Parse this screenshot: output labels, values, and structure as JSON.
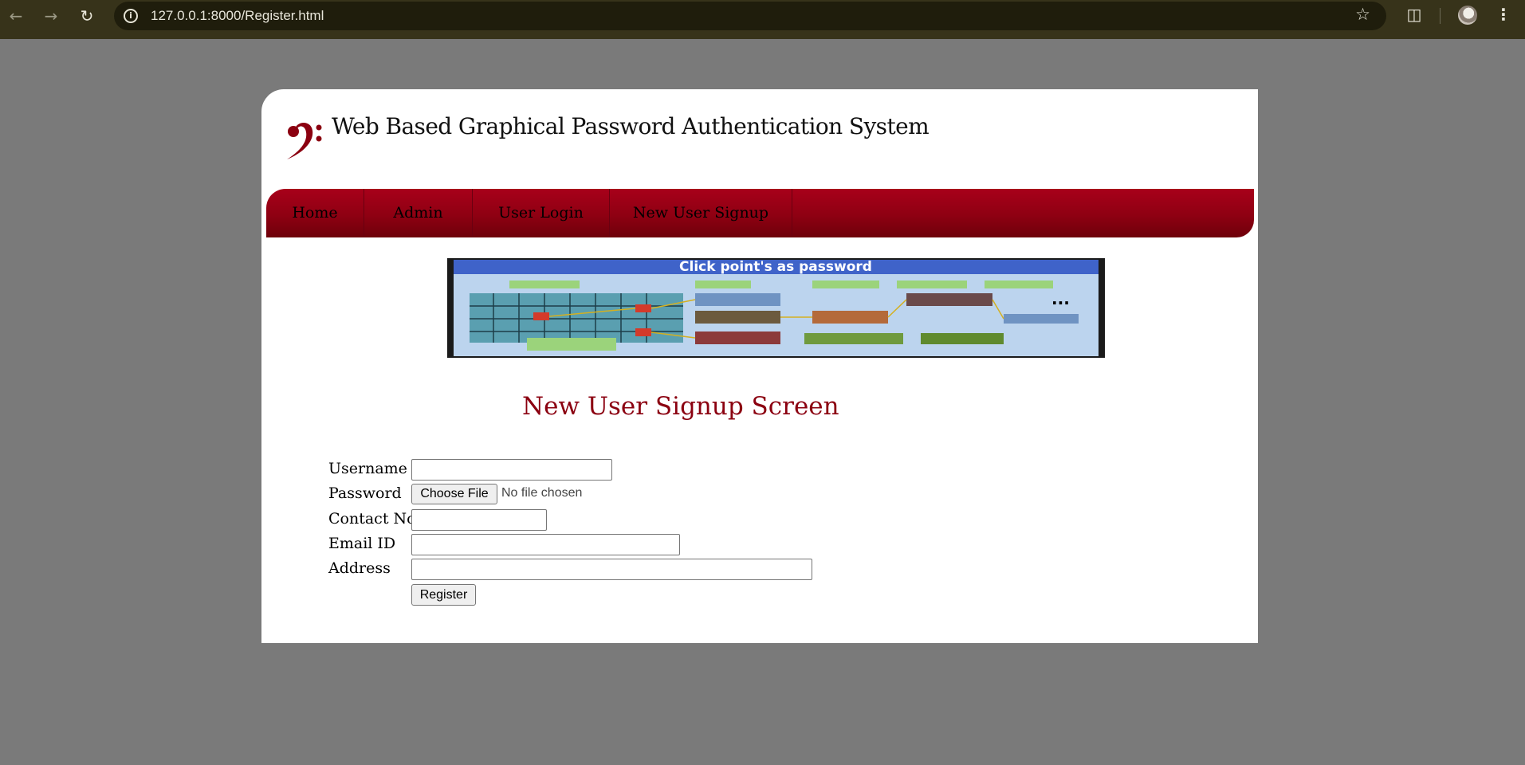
{
  "browser": {
    "url": "127.0.0.1:8000/Register.html",
    "icons": [
      "back-icon",
      "forward-icon",
      "reload-icon",
      "info-icon",
      "star-icon",
      "extensions-icon",
      "avatar",
      "menu-icon"
    ]
  },
  "site": {
    "title": "Web Based Graphical Password Authentication System",
    "logo": "bass-clef-icon",
    "accent_color": "#8b0010"
  },
  "menu": {
    "items": [
      {
        "label": "Home"
      },
      {
        "label": "Admin"
      },
      {
        "label": "User Login"
      },
      {
        "label": "New User Signup"
      }
    ]
  },
  "banner": {
    "caption": "Click point's as password"
  },
  "form": {
    "title": "New User Signup Screen",
    "fields": {
      "username": {
        "label": "Username",
        "value": ""
      },
      "password": {
        "label": "Password",
        "button": "Choose File",
        "status": "No file chosen"
      },
      "contact": {
        "label": "Contact No",
        "value": ""
      },
      "email": {
        "label": "Email ID",
        "value": ""
      },
      "address": {
        "label": "Address",
        "value": ""
      }
    },
    "submit_label": "Register"
  }
}
